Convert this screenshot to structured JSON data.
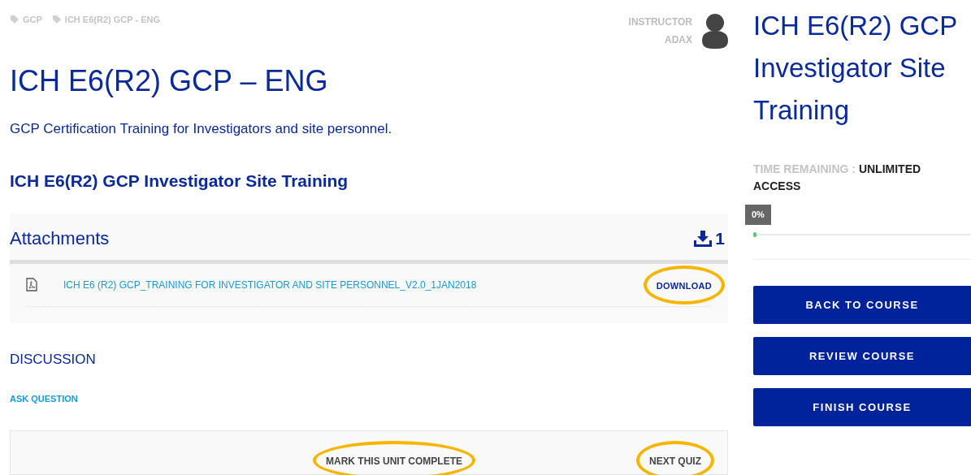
{
  "breadcrumbs": [
    "GCP",
    "ICH E6(R2) GCP - ENG"
  ],
  "instructor": {
    "label": "INSTRUCTOR",
    "name": "ADAX"
  },
  "title": "ICH E6(R2) GCP – ENG",
  "subtitle": "GCP Certification Training for Investigators and site personnel.",
  "unit_title": "ICH E6(R2) GCP Investigator Site Training",
  "attachments": {
    "heading": "Attachments",
    "count": "1",
    "files": [
      {
        "name": "ICH E6 (R2) GCP_TRAINING FOR INVESTIGATOR AND SITE PERSONNEL_V2.0_1JAN2018",
        "action": "DOWNLOAD",
        "circled": true
      }
    ]
  },
  "discussion": {
    "heading": "DISCUSSION",
    "link": "ASK QUESTION"
  },
  "footer_buttons": [
    {
      "label": "MARK THIS UNIT COMPLETE",
      "circled": true
    },
    {
      "label": "NEXT QUIZ",
      "circled": true
    }
  ],
  "sidebar": {
    "title_lines": [
      "ICH E6(R2) GCP",
      "Investigator Site",
      "Training"
    ],
    "time_label": "TIME REMAINING :",
    "time_value": "UNLIMITED ACCESS",
    "progress": {
      "label": "0%",
      "level": 0
    },
    "buttons": [
      "BACK TO COURSE",
      "REVIEW COURSE",
      "FINISH COURSE"
    ]
  }
}
